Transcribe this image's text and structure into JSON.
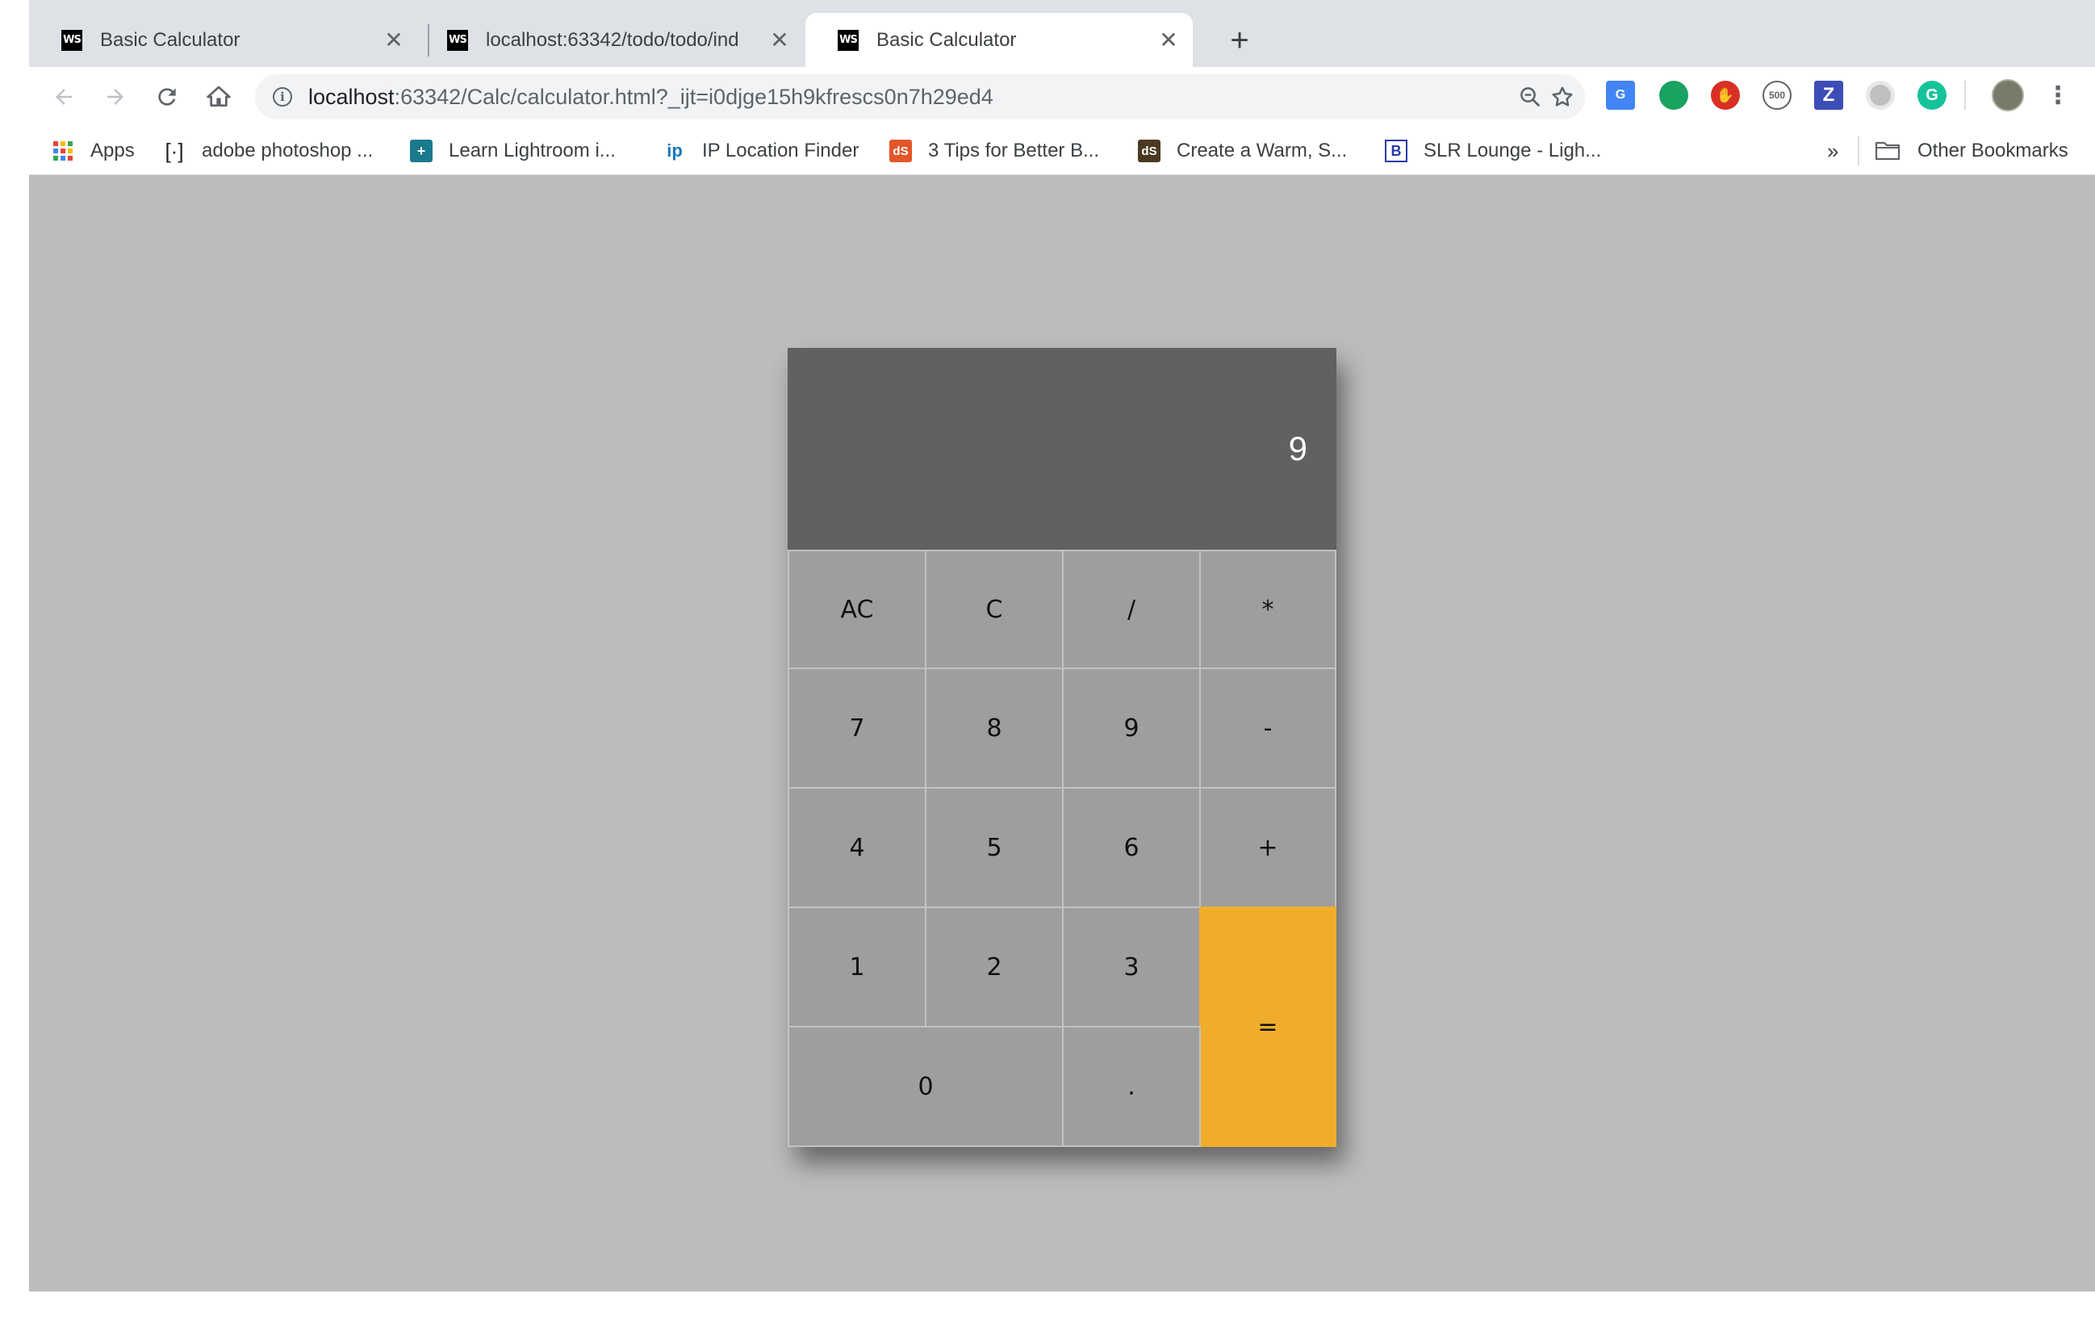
{
  "tabs": [
    {
      "title": "Basic Calculator",
      "active": false
    },
    {
      "title": "localhost:63342/todo/todo/ind",
      "active": false
    },
    {
      "title": "Basic Calculator",
      "active": true
    }
  ],
  "tab_icon_text": "WS",
  "close_glyph": "✕",
  "new_tab_glyph": "+",
  "address": {
    "host": "localhost",
    "rest": ":63342/Calc/calculator.html?_ijt=i0djge15h9kfrescs0n7h29ed4"
  },
  "bookmarks": {
    "items": [
      {
        "label": "Apps",
        "icon": "apps-grid-icon"
      },
      {
        "label": "adobe photoshop ...",
        "icon": "brackets-icon"
      },
      {
        "label": "Learn Lightroom i...",
        "icon": "lightroom-icon"
      },
      {
        "label": "IP Location Finder",
        "icon": "ip-icon"
      },
      {
        "label": "3 Tips for Better B...",
        "icon": "dps-icon"
      },
      {
        "label": "Create a Warm, S...",
        "icon": "dps-dark-icon"
      },
      {
        "label": "SLR Lounge - Ligh...",
        "icon": "slr-icon"
      }
    ],
    "overflow": "»",
    "other": "Other Bookmarks"
  },
  "calculator": {
    "display": "9",
    "keys": [
      "AC",
      "C",
      "/",
      "*",
      "7",
      "8",
      "9",
      "-",
      "4",
      "5",
      "6",
      "+",
      "1",
      "2",
      "3",
      "=",
      "0",
      "."
    ]
  },
  "colors": {
    "display_bg": "#616161",
    "key_bg": "#9e9e9e",
    "equals_bg": "#f0ad2c",
    "page_bg": "#bcbcbc"
  }
}
